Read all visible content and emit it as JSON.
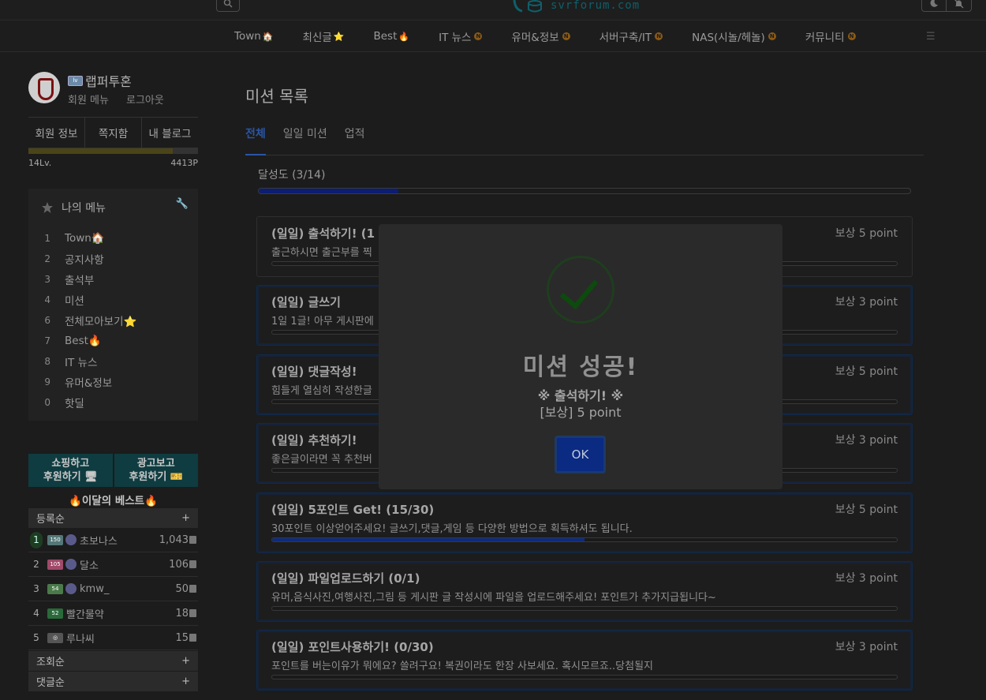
{
  "site": {
    "domain": "svrforum.com"
  },
  "nav": {
    "items": [
      {
        "label": "Town",
        "emoji": "🏠",
        "badge": ""
      },
      {
        "label": "최신글",
        "emoji": "⭐",
        "badge": ""
      },
      {
        "label": "Best",
        "emoji": "🔥",
        "badge": ""
      },
      {
        "label": "IT 뉴스",
        "emoji": "",
        "badge": "N"
      },
      {
        "label": "유머&정보",
        "emoji": "",
        "badge": "N"
      },
      {
        "label": "서버구축/IT",
        "emoji": "",
        "badge": "N"
      },
      {
        "label": "NAS(시놀/헤놀)",
        "emoji": "",
        "badge": "N"
      },
      {
        "label": "커뮤니티",
        "emoji": "",
        "badge": "N"
      }
    ]
  },
  "profile": {
    "nickname": "랩퍼투혼",
    "member_menu": "회원 메뉴",
    "logout": "로그아웃",
    "tabs": [
      "회원 정보",
      "쪽지함",
      "내 블로그"
    ],
    "level": "14Lv.",
    "points": "4413P",
    "level_progress": 0.85
  },
  "my_menu": {
    "title": "나의 메뉴",
    "items": [
      {
        "key": "1",
        "label": "Town🏠"
      },
      {
        "key": "2",
        "label": "공지사항"
      },
      {
        "key": "3",
        "label": "출석부"
      },
      {
        "key": "4",
        "label": "미션"
      },
      {
        "key": "6",
        "label": "전체모아보기⭐"
      },
      {
        "key": "7",
        "label": "Best🔥"
      },
      {
        "key": "8",
        "label": "IT 뉴스"
      },
      {
        "key": "9",
        "label": "유머&정보"
      },
      {
        "key": "0",
        "label": "핫딜"
      }
    ]
  },
  "promo": {
    "shop_line1": "쇼핑하고",
    "shop_line2": "후원하기",
    "ad_line1": "광고보고",
    "ad_line2": "후원하기"
  },
  "best": {
    "title": "이달의 베스트",
    "sections": [
      "등록순",
      "조회순",
      "댓글순"
    ],
    "expand": "+",
    "ranks": [
      {
        "rank": "1",
        "level": "150",
        "level_color": "#557777",
        "name": "초보나스",
        "points": "1,043"
      },
      {
        "rank": "2",
        "level": "105",
        "level_color": "#a04a6a",
        "name": "달소",
        "points": "106"
      },
      {
        "rank": "3",
        "level": "54",
        "level_color": "#4a7a4a",
        "name": "kmw_",
        "points": "50"
      },
      {
        "rank": "4",
        "level": "52",
        "level_color": "#2a6a3a",
        "name": "빨간물약",
        "points": "18"
      },
      {
        "rank": "5",
        "level": "◎",
        "level_color": "#555555",
        "name": "루나씨",
        "points": "15"
      }
    ]
  },
  "main": {
    "title": "미션 목록",
    "tabs": [
      "전체",
      "일일 미션",
      "업적"
    ],
    "progress_label": "달성도 (3/14)",
    "progress": 0.214,
    "missions": [
      {
        "title": "(일일) 출석하기! (1",
        "reward": "보상 5 point",
        "desc": "출근하시면 출근부를 찍",
        "progress": 0,
        "done": true
      },
      {
        "title": "(일일) 글쓰기",
        "reward": "보상 3 point",
        "desc": "1일 1글! 아무 게시판에",
        "progress": 0,
        "done": false
      },
      {
        "title": "(일일) 댓글작성!",
        "reward": "보상 5 point",
        "desc": "힘들게 열심히 작성한글",
        "progress": 0,
        "done": false
      },
      {
        "title": "(일일) 추천하기!",
        "reward": "보상 3 point",
        "desc": "좋은글이라면 꼭 추천버",
        "progress": 0,
        "done": false
      },
      {
        "title": "(일일) 5포인트 Get! (15/30)",
        "reward": "보상 5 point",
        "desc": "30포인트 이상얻어주세요! 글쓰기,댓글,게임 등 다양한 방법으로 획득하셔도 됩니다.",
        "progress": 0.5,
        "done": false
      },
      {
        "title": "(일일) 파일업로드하기 (0/1)",
        "reward": "보상 3 point",
        "desc": "유머,음식사진,여행사진,그림 등 게시판 글 작성시에 파일을 업로드해주세요! 포인트가 추가지급됩니다~",
        "progress": 0,
        "done": false
      },
      {
        "title": "(일일) 포인트사용하기! (0/30)",
        "reward": "보상 3 point",
        "desc": "포인트를 버는이유가 뭐에요? 쓸려구요! 복권이라도 한장 사보세요. 혹시모르죠..당첨될지",
        "progress": 0,
        "done": false
      }
    ]
  },
  "modal": {
    "title": "미션 성공!",
    "mission": "※ 출석하기! ※",
    "reward": "[보상] 5 point",
    "ok": "OK"
  }
}
